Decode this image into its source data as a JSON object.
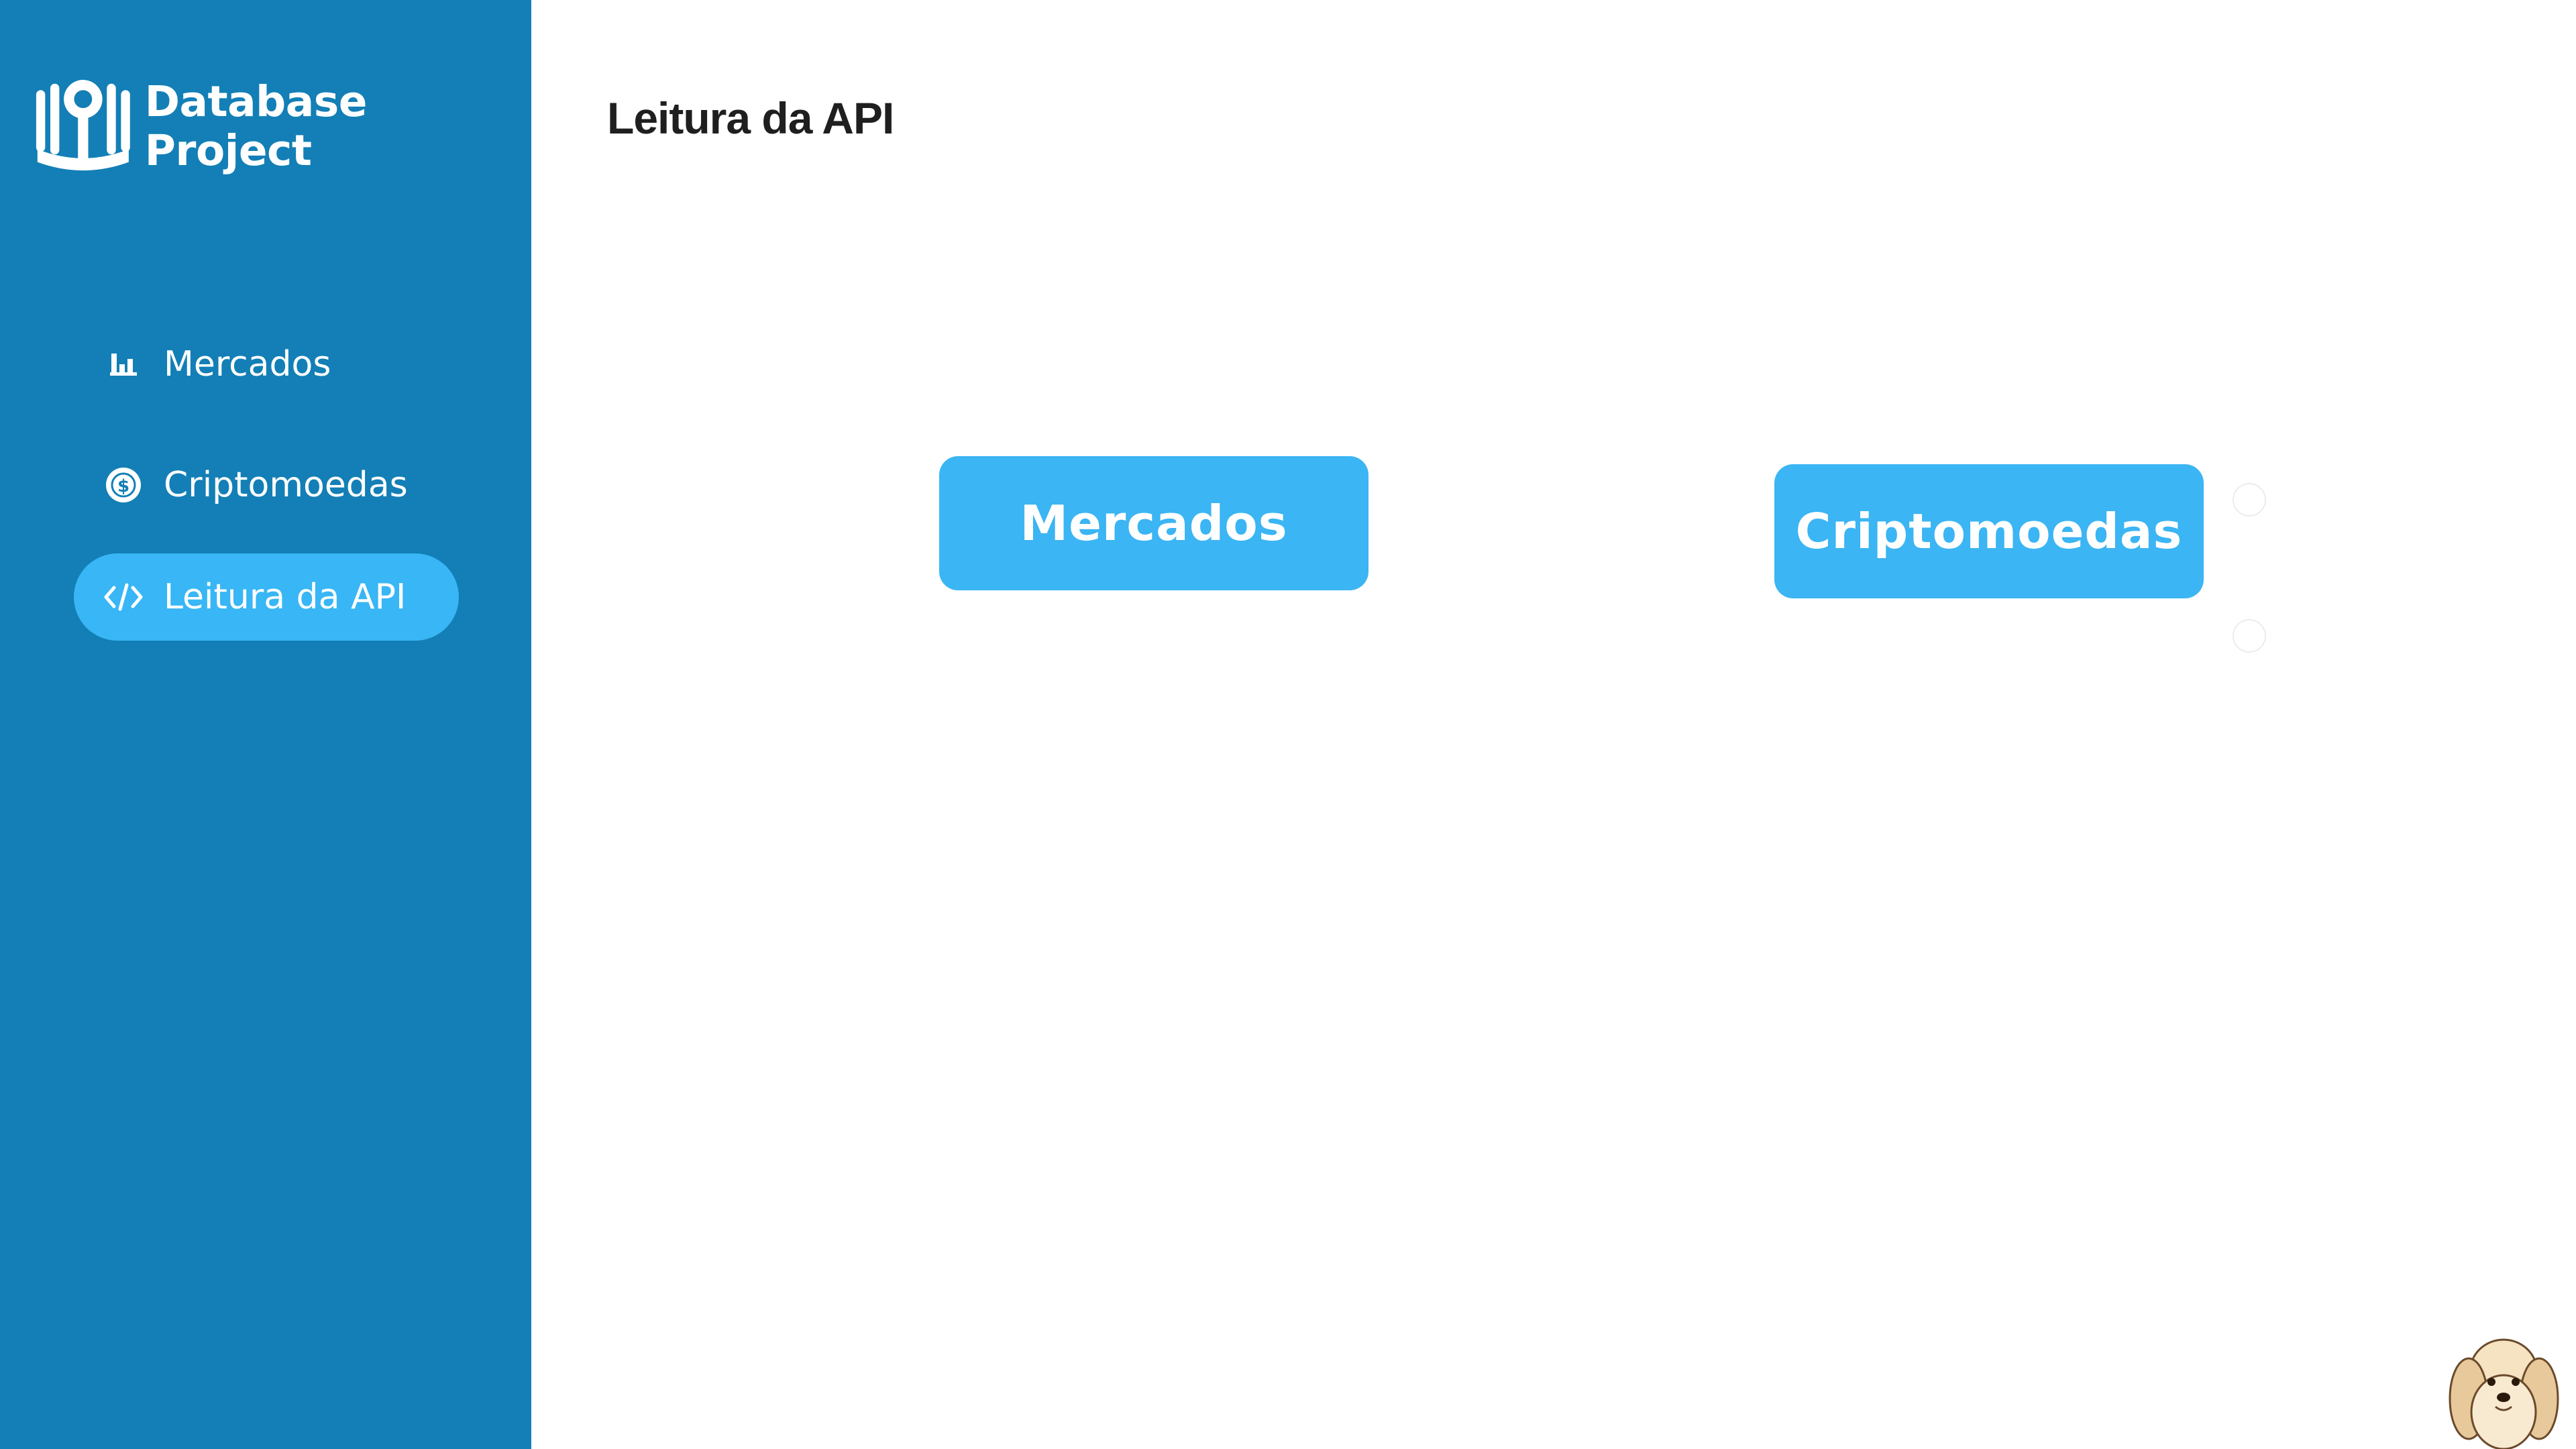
{
  "app": {
    "brand_title": "Database Project",
    "icon_names": [
      "university-logo-icon",
      "bar-chart-icon",
      "dollar-coin-icon",
      "code-icon",
      "dog-mascot-icon"
    ]
  },
  "sidebar": {
    "items": [
      {
        "label": "Mercados",
        "icon": "bar-chart-icon",
        "active": false
      },
      {
        "label": "Criptomoedas",
        "icon": "dollar-coin-icon",
        "active": false
      },
      {
        "label": "Leitura da API",
        "icon": "code-icon",
        "active": true
      }
    ]
  },
  "main": {
    "title": "Leitura da API",
    "buttons": {
      "mercados": "Mercados",
      "criptomoedas": "Criptomoedas"
    }
  },
  "colors": {
    "sidebar_bg": "#137fb6",
    "accent": "#38b6f5",
    "button_bg": "#3bb5f3",
    "text_dark": "#1f1f1f",
    "text_light": "#ffffff"
  }
}
